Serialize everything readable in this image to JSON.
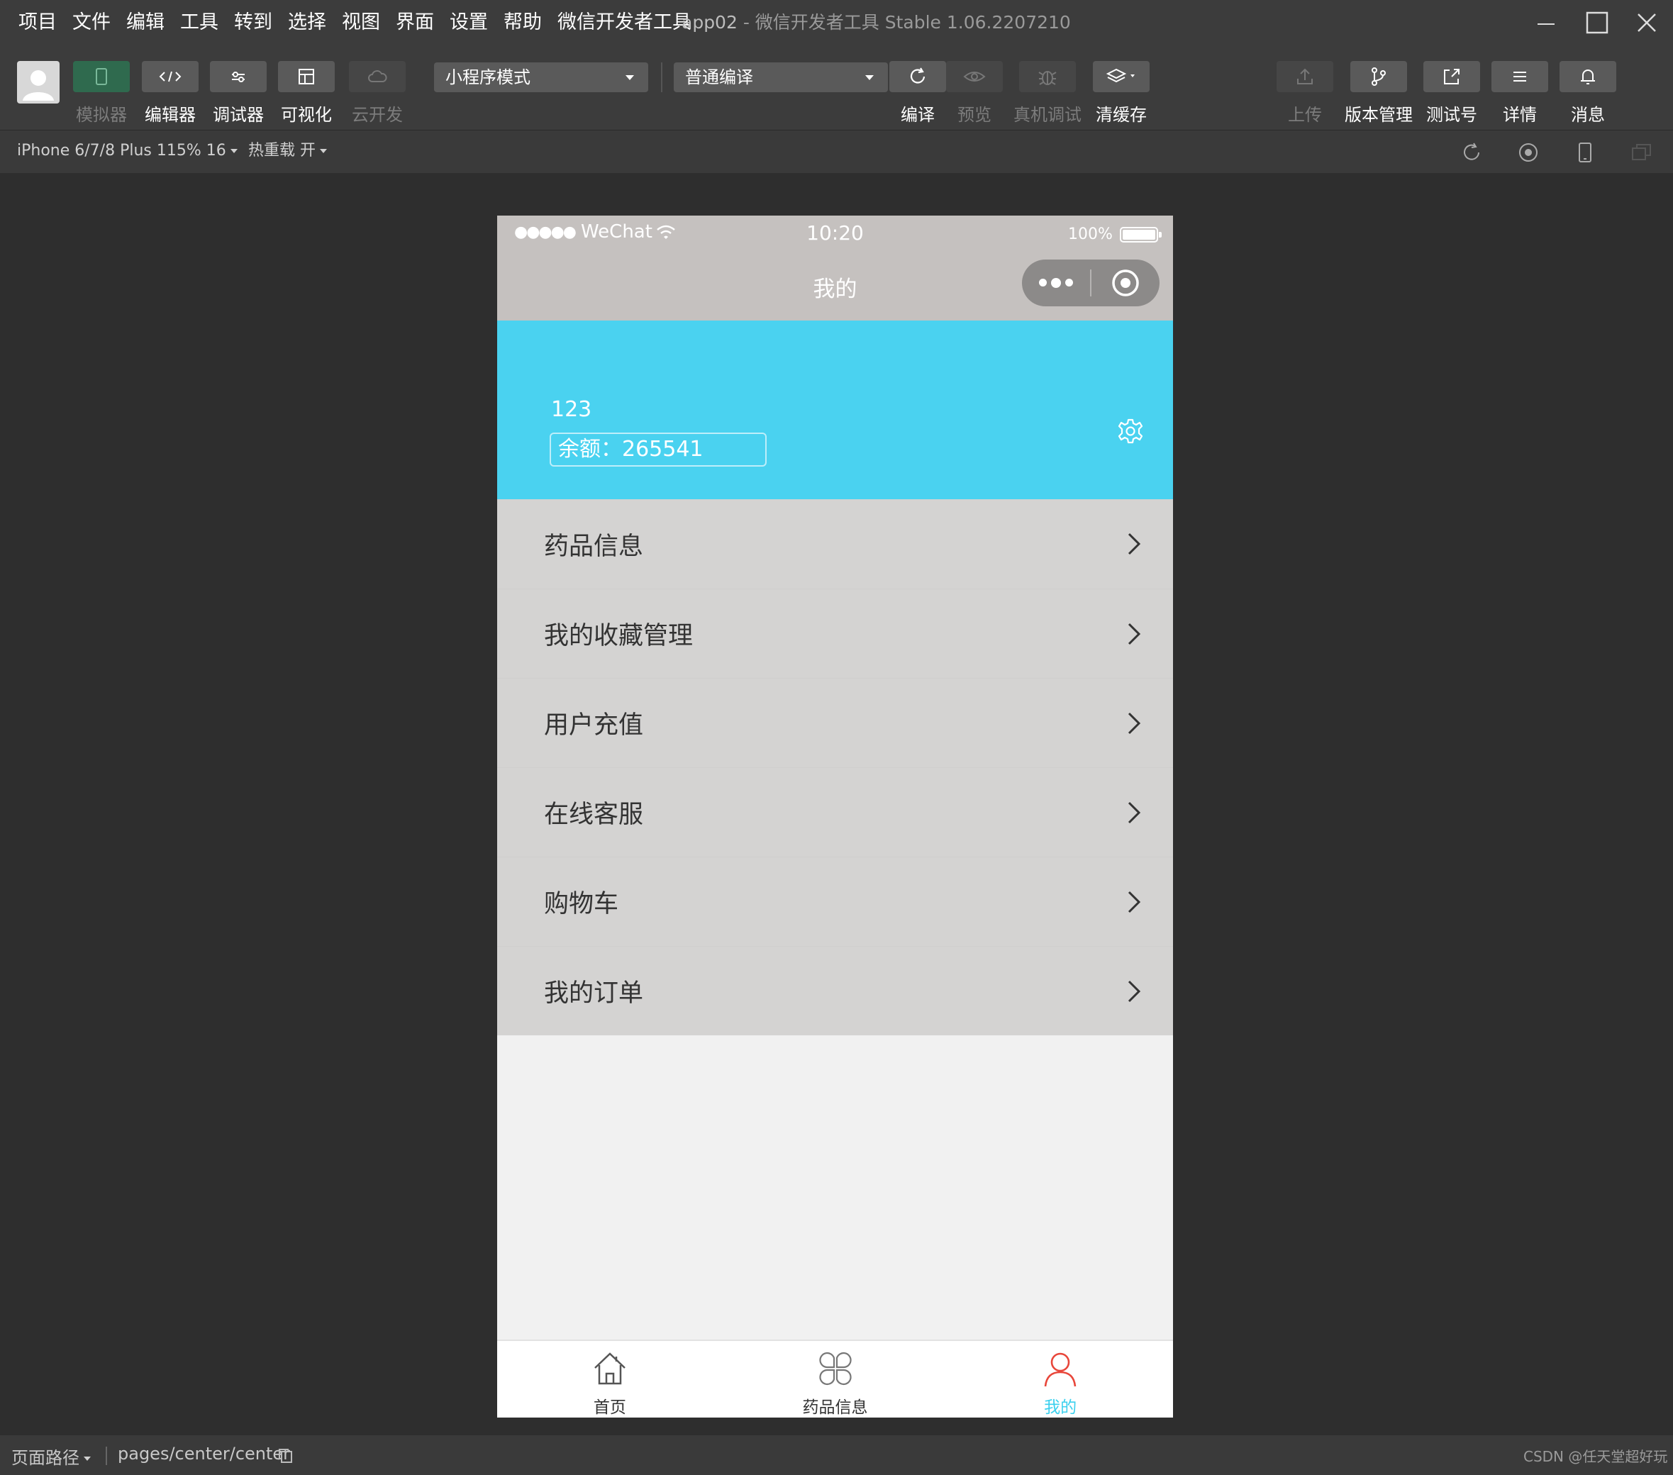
{
  "menubar": {
    "items": [
      "项目",
      "文件",
      "编辑",
      "工具",
      "转到",
      "选择",
      "视图",
      "界面",
      "设置",
      "帮助",
      "微信开发者工具"
    ],
    "project": "app02",
    "title_sep": " - ",
    "app_title": "微信开发者工具 Stable 1.06.2207210"
  },
  "toolbar": {
    "simulator": "模拟器",
    "editor": "编辑器",
    "debugger": "调试器",
    "visual": "可视化",
    "cloud": "云开发",
    "mode_select": "小程序模式",
    "compile_select": "普通编译",
    "compile": "编译",
    "preview": "预览",
    "remote_debug": "真机调试",
    "clear_cache": "清缓存",
    "upload": "上传",
    "version": "版本管理",
    "test_account": "测试号",
    "details": "详情",
    "messages": "消息"
  },
  "subbar": {
    "device": "iPhone 6/7/8 Plus 115% 16",
    "hot_reload": "热重载 开"
  },
  "phone": {
    "status": {
      "carrier": "WeChat",
      "signal_dots": "●●●●●",
      "time": "10:20",
      "battery": "100%"
    },
    "nav_title": "我的",
    "profile": {
      "name": "123",
      "balance": "余额：265541"
    },
    "menu": [
      {
        "label": "药品信息"
      },
      {
        "label": "我的收藏管理"
      },
      {
        "label": "用户充值"
      },
      {
        "label": "在线客服"
      },
      {
        "label": "购物车"
      },
      {
        "label": "我的订单"
      }
    ],
    "tabs": [
      {
        "label": "首页"
      },
      {
        "label": "药品信息"
      },
      {
        "label": "我的"
      }
    ]
  },
  "footer": {
    "path_label": "页面路径",
    "page_path": "pages/center/center",
    "watermark": "CSDN @任天堂超好玩"
  },
  "colors": {
    "accent": "#4ad2f0",
    "active_tab": "#3ad0ee",
    "active_tab_icon": "#e8463a",
    "nav_gray": "#c5c1bf"
  }
}
